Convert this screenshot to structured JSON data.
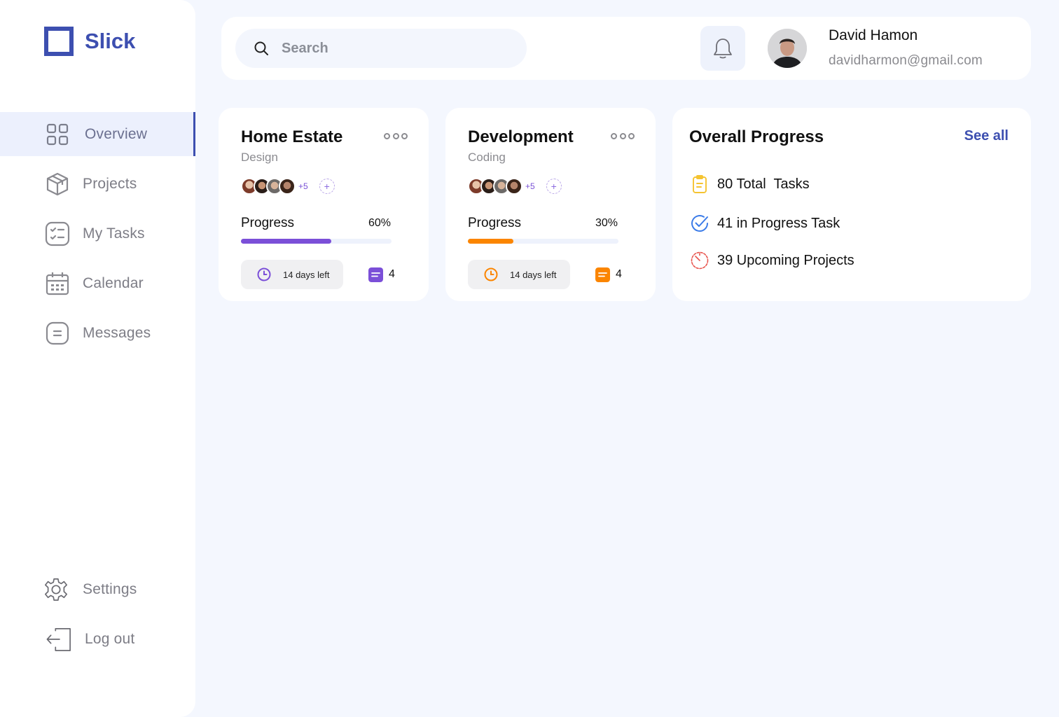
{
  "brand": {
    "name": "Slick",
    "color": "#3d4fb0"
  },
  "sidebar": {
    "items": [
      {
        "label": "Overview",
        "icon": "grid-icon",
        "active": true
      },
      {
        "label": "Projects",
        "icon": "cube-icon"
      },
      {
        "label": "My Tasks",
        "icon": "checklist-icon"
      },
      {
        "label": "Calendar",
        "icon": "calendar-icon"
      },
      {
        "label": "Messages",
        "icon": "message-icon"
      }
    ],
    "bottom": [
      {
        "label": "Settings",
        "icon": "gear-icon"
      },
      {
        "label": "Log out",
        "icon": "logout-icon"
      }
    ]
  },
  "header": {
    "search": {
      "placeholder": "Search"
    },
    "notification_icon": "bell-icon",
    "user": {
      "name": "David Hamon",
      "email": "davidharmon@gmail.com"
    }
  },
  "projects": [
    {
      "title": "Home Estate",
      "subtitle": "Design",
      "extra_members": "+5",
      "progress_label": "Progress",
      "progress_text": "60%",
      "progress": 0.6,
      "days_left": "14 days left",
      "messages": "4",
      "accent": "#7b4fd8"
    },
    {
      "title": "Development",
      "subtitle": "Coding",
      "extra_members": "+5",
      "progress_label": "Progress",
      "progress_text": "30%",
      "progress": 0.3,
      "days_left": "14 days left",
      "messages": "4",
      "accent": "#fb8500"
    }
  ],
  "overall": {
    "title": "Overall Progress",
    "see_all": "See all",
    "stats": [
      {
        "text": "80 Total  Tasks",
        "icon": "clipboard-icon",
        "color": "#f5c431"
      },
      {
        "text": "41 in Progress Task",
        "icon": "check-circle-icon",
        "color": "#3b7be8"
      },
      {
        "text": "39 Upcoming Projects",
        "icon": "timer-icon",
        "color": "#e8554e"
      }
    ]
  }
}
